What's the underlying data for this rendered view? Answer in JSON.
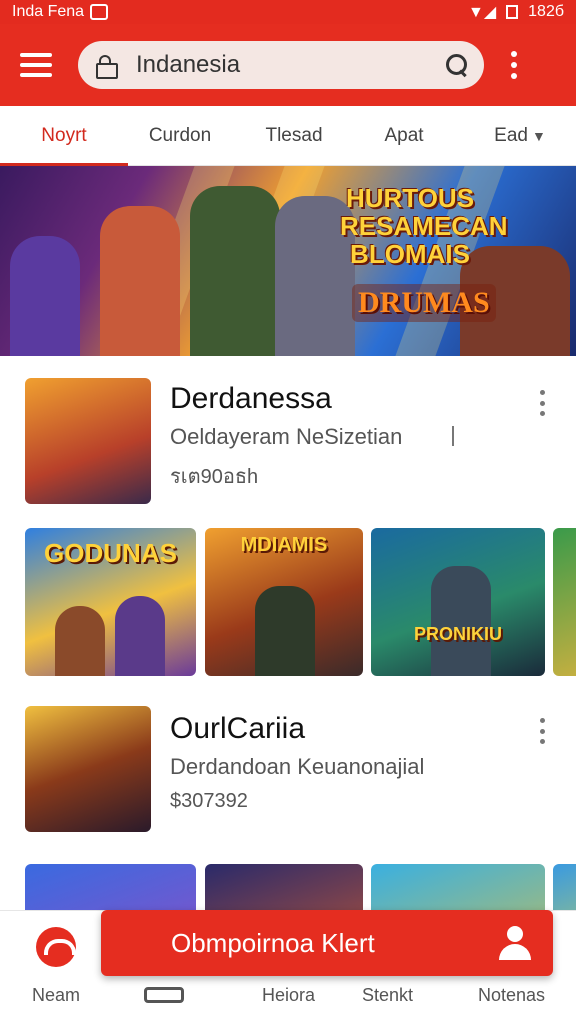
{
  "status_bar": {
    "title": "Inda Fena",
    "time": "182б"
  },
  "app_bar": {
    "search_value": "Indanesia"
  },
  "tabs": [
    {
      "label": "Noyrt",
      "active": true
    },
    {
      "label": "Curdon"
    },
    {
      "label": "Tlesad"
    },
    {
      "label": "Apat"
    },
    {
      "label": "Ead"
    }
  ],
  "banner": {
    "title": "HURTOUS RESAMECAN BLOMAIS",
    "subtitle": "DRUMAS"
  },
  "cards": [
    {
      "title": "Derdanessa",
      "subtitle": "Oeldayeram NeSizetian",
      "price": "รเต90อธh"
    },
    {
      "title": "OurlCariia",
      "subtitle": "Derdandoan Keuanonajial",
      "price": "$307392"
    }
  ],
  "row1_tiles": [
    {
      "label": "GODUNAS"
    },
    {
      "label": "MDIAMIS"
    },
    {
      "label": "PRONIKIU"
    },
    {
      "label": ""
    }
  ],
  "cta": {
    "label": "Obmpoirnoa Klert"
  },
  "bottom_nav": [
    {
      "label": "Neam"
    },
    {
      "label": ""
    },
    {
      "label": "Heiora"
    },
    {
      "label": "Stenkt"
    },
    {
      "label": "Notenas"
    }
  ],
  "colors": {
    "brand_red": "#e52d20",
    "tab_active": "#d22a1e"
  }
}
